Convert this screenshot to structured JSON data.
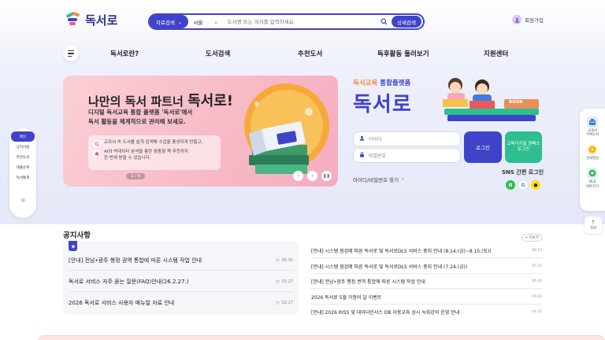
{
  "header": {
    "logo_text": "독서로",
    "search": {
      "type_label": "자료검색",
      "region_label": "서울",
      "placeholder": "도서명 또는 저자를 입력하세요.",
      "button_label": "상세검색"
    },
    "signup_label": "회원가입"
  },
  "nav": {
    "items": [
      "독서로란?",
      "도서검색",
      "추천도서",
      "독후활동 둘러보기",
      "지원센터"
    ]
  },
  "left_nav": {
    "items": [
      "메인",
      "공지사항",
      "추천도서",
      "대출순위",
      "독서통계"
    ]
  },
  "right_nav": {
    "items": [
      "교과서\n수록도서",
      "안내영상",
      "DLS\n바로가기"
    ],
    "top_label": "TOP"
  },
  "banner": {
    "title_prefix": "나만의 독서 파트너",
    "title_brand": "독서로!",
    "desc_line1": "디지털 독서교육 통합 플랫폼 '독서로'에서",
    "desc_line2": "독서 활동을 체계적으로 관리해 보세요.",
    "feature1": "교과서 속 도서를 쉽게 검색해 수업을 풍성하게 만들고,",
    "feature2_line1": "AI와 빅데이터 분석을 통한 맞춤형 책 추천까지",
    "feature2_line2": "한 번에 받을 수 있습니다.",
    "page_indicator": "1 / 6",
    "book_label": "BOOK"
  },
  "login": {
    "brand_sub_a": "독서교육",
    "brand_sub_b": "통합플랫폼",
    "brand_big": "독서로",
    "id_placeholder": "아이디",
    "pw_placeholder": "비밀번호",
    "login_label": "로그인",
    "cert_label": "교육디지털 원패스 로그인",
    "find_label": "아이디/비밀번호 찾기",
    "sns_label": "SNS 간편 로그인"
  },
  "notices": {
    "title": "공지사항",
    "more_label": "+ 더보기",
    "left": [
      {
        "text": "[안내] 전남•광주 행정 권역 통합에 따른 시스템 작업 안내",
        "date": "06.30"
      },
      {
        "text": "독서로 서비스 자주 묻는 질문(FAQ)안내(26.2.27.)",
        "date": "02.27"
      },
      {
        "text": "2026 독서로 서비스 사용자 매뉴얼 자료 안내",
        "date": "02.27"
      }
    ],
    "right": [
      {
        "text": "[안내] 시스템 점검에 따른 독서로 및 독서로DLS 서비스 중지 안내 (8.14.(금)~8.15.(토))",
        "date": "08.10"
      },
      {
        "text": "[안내] 시스템 점검에 따른 독서로 및 독서로DLS 서비스 중지 안내 (7.24.(금))",
        "date": "07.21"
      },
      {
        "text": "[안내] 전남•광주 행정 권역 통합에 따른 시스템 작업 안내",
        "date": "06.30"
      },
      {
        "text": "2026 독서로 5월 가정의 달 이벤트",
        "date": "05.04"
      },
      {
        "text": "[안내] 2026 RISS 및 데이터인서스 DB 이용교육 상시 녹화강의 운영 안내",
        "date": "04.22"
      }
    ]
  }
}
